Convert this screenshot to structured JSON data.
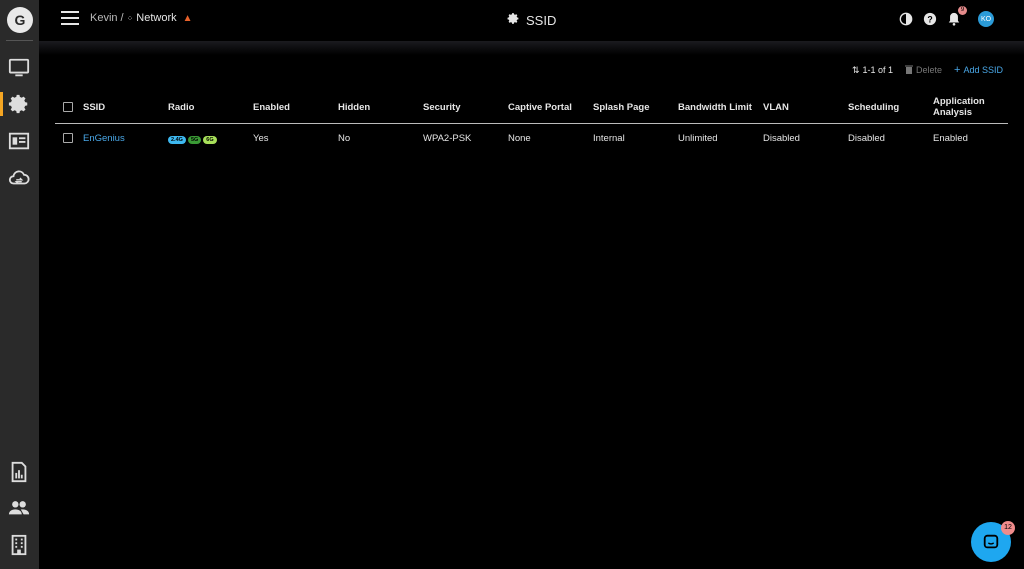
{
  "breadcrumb": {
    "org": "Kevin",
    "separator": "/",
    "network": "Network"
  },
  "page": {
    "title": "SSID"
  },
  "header": {
    "notification_count": "9",
    "avatar_initials": "KO"
  },
  "toolbar": {
    "pagination": "1-1 of 1",
    "delete_label": "Delete",
    "add_label": "Add SSID"
  },
  "table": {
    "columns": [
      "SSID",
      "Radio",
      "Enabled",
      "Hidden",
      "Security",
      "Captive Portal",
      "Splash Page",
      "Bandwidth Limit",
      "VLAN",
      "Scheduling",
      "Application Analysis"
    ],
    "rows": [
      {
        "ssid": "EnGenius",
        "radios": [
          {
            "label": "2.4G",
            "color": "#3db8f0"
          },
          {
            "label": "5G",
            "color": "#3a9a35"
          },
          {
            "label": "6G",
            "color": "#a8e05a"
          }
        ],
        "enabled": "Yes",
        "hidden": "No",
        "security": "WPA2-PSK",
        "captive_portal": "None",
        "splash_page": "Internal",
        "bandwidth_limit": "Unlimited",
        "vlan": "Disabled",
        "scheduling": "Disabled",
        "application_analysis": "Enabled"
      }
    ]
  },
  "chat": {
    "badge_count": "12"
  },
  "colors": {
    "accent": "#4aa8e8",
    "sidebar_bg": "#2a2a2a",
    "warning": "#e8622b",
    "chat": "#1ea7f0"
  },
  "sidebar": {
    "top_icons": [
      "monitor-icon",
      "gear-icon",
      "list-icon",
      "cloud-sync-icon"
    ],
    "bottom_icons": [
      "report-icon",
      "users-icon",
      "building-icon"
    ]
  }
}
